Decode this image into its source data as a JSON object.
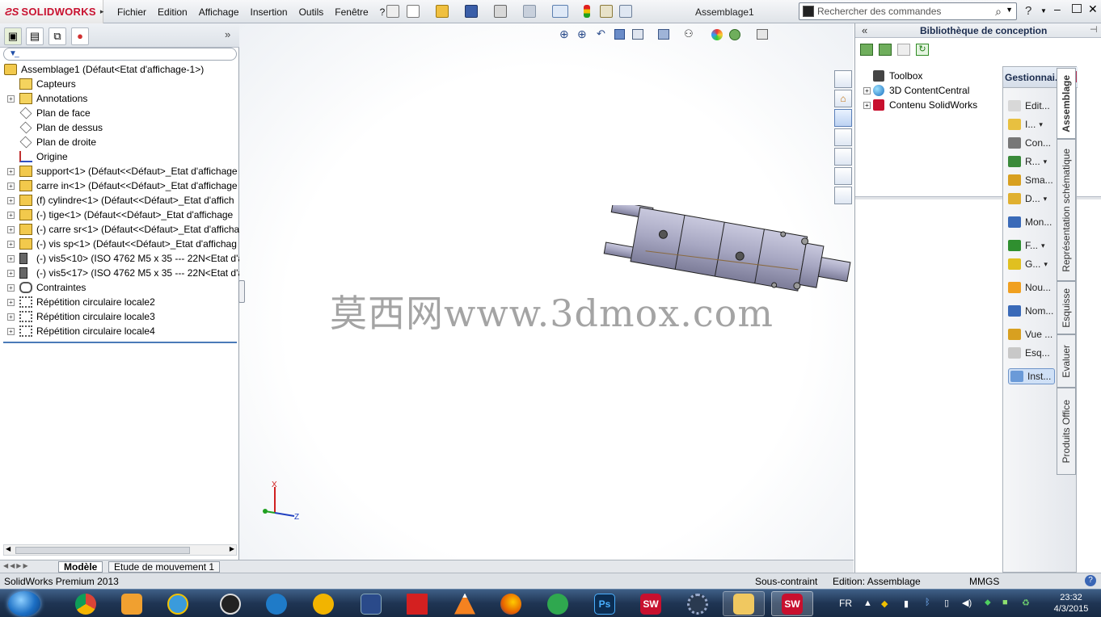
{
  "app": {
    "logo_prefix": "ƧS",
    "logo_name": "SOLIDWORKS",
    "doc_title": "Assemblage1"
  },
  "menu": [
    "Fichier",
    "Edition",
    "Affichage",
    "Insertion",
    "Outils",
    "Fenêtre",
    "?"
  ],
  "search": {
    "placeholder": "Rechercher des commandes"
  },
  "tree": {
    "root": "Assemblage1  (Défaut<Etat d'affichage-1>)",
    "items": [
      {
        "label": "Capteurs",
        "expander": false,
        "icon": "sensor-icon"
      },
      {
        "label": "Annotations",
        "expander": true,
        "icon": "annotation-icon"
      },
      {
        "label": "Plan de face",
        "expander": false,
        "icon": "plane-icon"
      },
      {
        "label": "Plan de dessus",
        "expander": false,
        "icon": "plane-icon"
      },
      {
        "label": "Plan de droite",
        "expander": false,
        "icon": "plane-icon"
      },
      {
        "label": "Origine",
        "expander": false,
        "icon": "origin-icon"
      },
      {
        "label": "support<1> (Défaut<<Défaut>_Etat d'affichage",
        "expander": true,
        "icon": "part-icon"
      },
      {
        "label": "carre in<1> (Défaut<<Défaut>_Etat d'affichage",
        "expander": true,
        "icon": "part-icon"
      },
      {
        "label": "(f) cylindre<1> (Défaut<<Défaut>_Etat d'affich",
        "expander": true,
        "icon": "part-icon"
      },
      {
        "label": "(-) tige<1> (Défaut<<Défaut>_Etat d'affichage",
        "expander": true,
        "icon": "part-icon"
      },
      {
        "label": "(-) carre sr<1> (Défaut<<Défaut>_Etat d'afficha",
        "expander": true,
        "icon": "part-icon"
      },
      {
        "label": "(-) vis sp<1> (Défaut<<Défaut>_Etat d'affichag",
        "expander": true,
        "icon": "part-icon"
      },
      {
        "label": "(-) vis5<10> (ISO 4762 M5 x 35 --- 22N<Etat d'a",
        "expander": true,
        "icon": "screw-icon"
      },
      {
        "label": "(-) vis5<17> (ISO 4762 M5 x 35 --- 22N<Etat d'a",
        "expander": true,
        "icon": "screw-icon"
      },
      {
        "label": "Contraintes",
        "expander": true,
        "icon": "mates-icon"
      },
      {
        "label": "Répétition circulaire locale2",
        "expander": true,
        "icon": "pattern-icon"
      },
      {
        "label": "Répétition circulaire locale3",
        "expander": true,
        "icon": "pattern-icon"
      },
      {
        "label": "Répétition circulaire locale4",
        "expander": true,
        "icon": "pattern-icon"
      }
    ]
  },
  "bottom_tabs": [
    "Modèle",
    "Etude de mouvement 1"
  ],
  "watermark": "莫西网www.3dmox.com",
  "triad": {
    "x": "X",
    "z": "Z"
  },
  "design_library": {
    "title": "Bibliothèque de conception",
    "items": [
      "Toolbox",
      "3D ContentCentral",
      "Contenu SolidWorks"
    ]
  },
  "command_manager": {
    "title": "Gestionnai...",
    "buttons": [
      "Edit...",
      "I...",
      "Con...",
      "R...",
      "Sma...",
      "D...",
      "Mon...",
      "F...",
      "G...",
      "Nou...",
      "Nom...",
      "Vue ...",
      "Esq...",
      "Inst..."
    ]
  },
  "vertical_tabs": [
    "Assemblage",
    "Représentation schématique",
    "Esquisse",
    "Evaluer",
    "Produits Office"
  ],
  "status": {
    "product": "SolidWorks Premium 2013",
    "state": "Sous-contraint",
    "mode": "Edition: Assemblage",
    "units": "MMGS"
  },
  "taskbar": {
    "lang": "FR",
    "time": "23:32",
    "date": "4/3/2015"
  },
  "colors": {
    "accent": "#c8102e",
    "taskbar": "#1f3553",
    "cad_part": "#a9a9c4"
  }
}
